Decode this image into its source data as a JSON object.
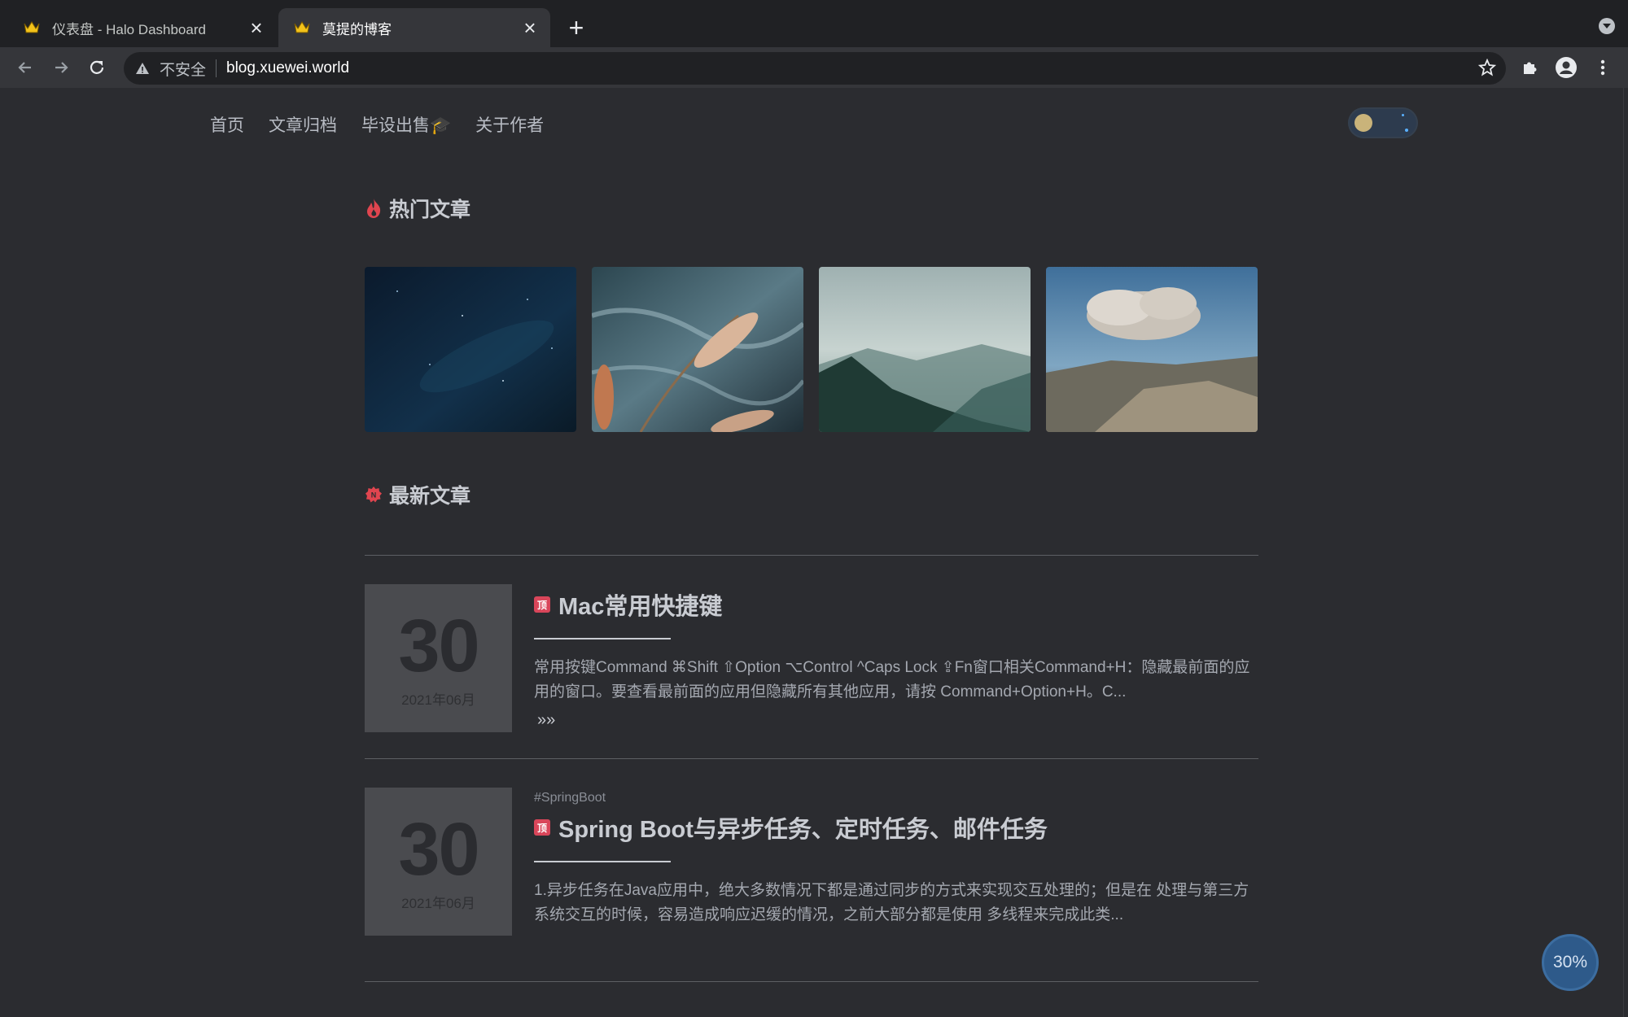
{
  "browser": {
    "tabs": [
      {
        "title": "仪表盘 - Halo Dashboard",
        "active": false
      },
      {
        "title": "莫提的博客",
        "active": true
      }
    ],
    "new_tab": "+",
    "security_label": "不安全",
    "url": "blog.xuewei.world"
  },
  "site": {
    "nav": [
      "首页",
      "文章归档",
      "毕设出售🎓",
      "关于作者"
    ],
    "theme_toggle": "dark"
  },
  "hot": {
    "title": "热门文章",
    "icon": "flame-icon",
    "thumbs": [
      "starry-night-sky",
      "pampas-grass-over-surf",
      "misty-forest-mountains",
      "smoke-cloud-over-ridge"
    ]
  },
  "latest": {
    "title": "最新文章",
    "icon": "new-badge-icon",
    "posts": [
      {
        "day": "30",
        "yearmonth": "2021年06月",
        "tag": "",
        "badge": "顶",
        "title": "Mac常用快捷键",
        "excerpt": "常用按键Command ⌘Shift ⇧Option ⌥Control ^Caps Lock ⇪Fn窗口相关Command+H：隐藏最前面的应用的窗口。要查看最前面的应用但隐藏所有其他应用，请按 Command+Option+H。C...",
        "readmore": "»»"
      },
      {
        "day": "30",
        "yearmonth": "2021年06月",
        "tag": "#SpringBoot",
        "badge": "顶",
        "title": "Spring Boot与异步任务、定时任务、邮件任务",
        "excerpt": "1.异步任务在Java应用中，绝大多数情况下都是通过同步的方式来实现交互处理的；但是在 处理与第三方系统交互的时候，容易造成响应迟缓的情况，之前大部分都是使用 多线程来完成此类...",
        "readmore": ""
      }
    ]
  },
  "progress": {
    "label": "30%",
    "value": 0.3
  },
  "colors": {
    "accent": "#d9465a",
    "background": "#2b2c30",
    "progress": "#2e5a8a"
  }
}
